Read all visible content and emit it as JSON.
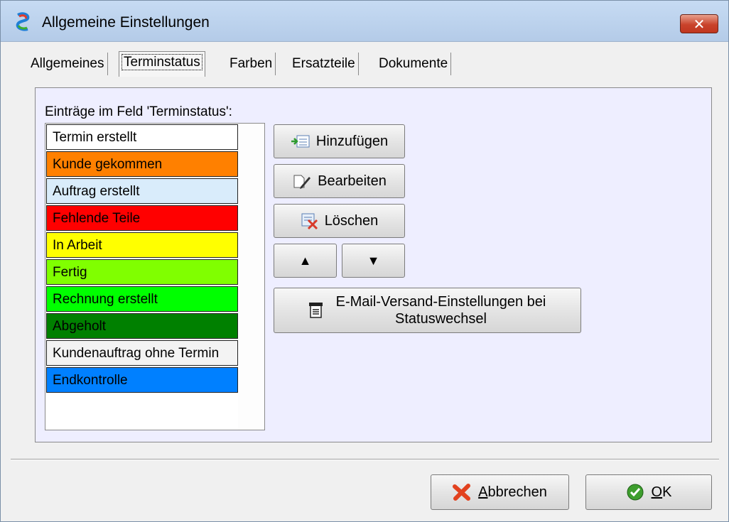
{
  "window": {
    "title": "Allgemeine Einstellungen",
    "close_label": "✕"
  },
  "tabs": [
    {
      "label": "Allgemeines",
      "active": false
    },
    {
      "label": "Terminstatus",
      "active": true
    },
    {
      "label": "Farben",
      "active": false
    },
    {
      "label": "Ersatzteile",
      "active": false
    },
    {
      "label": "Dokumente",
      "active": false
    }
  ],
  "status_list": {
    "label": "Einträge im Feld 'Terminstatus':",
    "items": [
      {
        "label": "Termin erstellt",
        "color": "#ffffff"
      },
      {
        "label": "Kunde gekommen",
        "color": "#ff8000"
      },
      {
        "label": "Auftrag erstellt",
        "color": "#d9ecfb"
      },
      {
        "label": "Fehlende Teile",
        "color": "#ff0000"
      },
      {
        "label": "In Arbeit",
        "color": "#ffff00"
      },
      {
        "label": "Fertig",
        "color": "#80ff00"
      },
      {
        "label": "Rechnung erstellt",
        "color": "#00ff00"
      },
      {
        "label": "Abgeholt",
        "color": "#008000"
      },
      {
        "label": "Kundenauftrag ohne Termin",
        "color": "#f3f3f3"
      },
      {
        "label": "Endkontrolle",
        "color": "#0080ff"
      }
    ]
  },
  "actions": {
    "add_label": "Hinzufügen",
    "edit_label": "Bearbeiten",
    "delete_label": "Löschen",
    "up_label": "▲",
    "down_label": "▼",
    "mail_line1": "E-Mail-Versand-Einstellungen bei",
    "mail_line2": "Statuswechsel"
  },
  "footer": {
    "cancel_prefix": "A",
    "cancel_rest": "bbrechen",
    "ok_prefix": "O",
    "ok_rest": "K"
  }
}
